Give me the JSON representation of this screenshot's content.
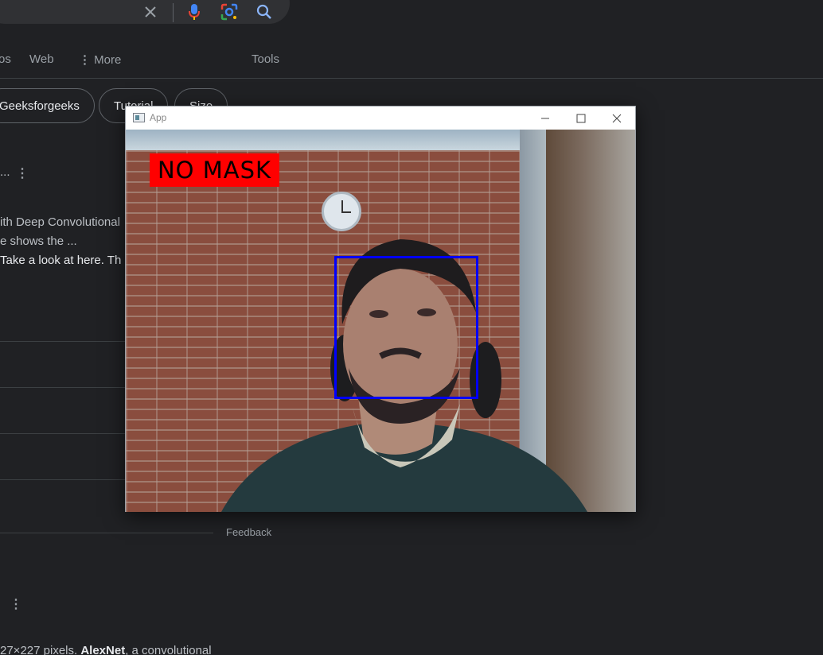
{
  "search": {
    "clear_icon": "close-icon",
    "voice_icon": "mic-icon",
    "lens_icon": "lens-icon",
    "search_icon": "search-icon"
  },
  "tabs": {
    "partial": "os",
    "web": "Web",
    "more": "More",
    "tools": "Tools"
  },
  "chips": [
    "Geeksforgeeks",
    "Tutorial",
    "Size"
  ],
  "results": {
    "snippet_1": "ith Deep Convolutional",
    "snippet_2": "e shows the ...",
    "snippet_3": " Take a look at here. Th",
    "bottom_text": "27×227 pixels. ",
    "bottom_bold": "AlexNet",
    "bottom_text_2": ", a convolutional",
    "feedback": "Feedback"
  },
  "app_window": {
    "title": "App",
    "minimize_icon": "minimize-icon",
    "maximize_icon": "maximize-icon",
    "close_icon": "close-icon",
    "detection_label": "NO MASK",
    "label_color": "#ff0000",
    "box_color": "#0000ff"
  }
}
